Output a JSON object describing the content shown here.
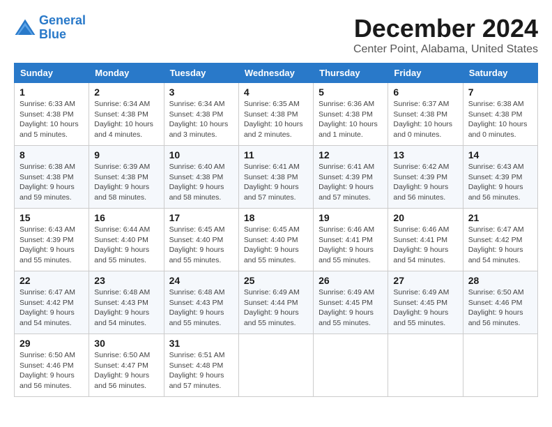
{
  "logo": {
    "line1": "General",
    "line2": "Blue"
  },
  "title": "December 2024",
  "subtitle": "Center Point, Alabama, United States",
  "weekdays": [
    "Sunday",
    "Monday",
    "Tuesday",
    "Wednesday",
    "Thursday",
    "Friday",
    "Saturday"
  ],
  "weeks": [
    [
      {
        "day": "1",
        "sunrise": "6:33 AM",
        "sunset": "4:38 PM",
        "daylight": "10 hours and 5 minutes."
      },
      {
        "day": "2",
        "sunrise": "6:34 AM",
        "sunset": "4:38 PM",
        "daylight": "10 hours and 4 minutes."
      },
      {
        "day": "3",
        "sunrise": "6:34 AM",
        "sunset": "4:38 PM",
        "daylight": "10 hours and 3 minutes."
      },
      {
        "day": "4",
        "sunrise": "6:35 AM",
        "sunset": "4:38 PM",
        "daylight": "10 hours and 2 minutes."
      },
      {
        "day": "5",
        "sunrise": "6:36 AM",
        "sunset": "4:38 PM",
        "daylight": "10 hours and 1 minute."
      },
      {
        "day": "6",
        "sunrise": "6:37 AM",
        "sunset": "4:38 PM",
        "daylight": "10 hours and 0 minutes."
      },
      {
        "day": "7",
        "sunrise": "6:38 AM",
        "sunset": "4:38 PM",
        "daylight": "10 hours and 0 minutes."
      }
    ],
    [
      {
        "day": "8",
        "sunrise": "6:38 AM",
        "sunset": "4:38 PM",
        "daylight": "9 hours and 59 minutes."
      },
      {
        "day": "9",
        "sunrise": "6:39 AM",
        "sunset": "4:38 PM",
        "daylight": "9 hours and 58 minutes."
      },
      {
        "day": "10",
        "sunrise": "6:40 AM",
        "sunset": "4:38 PM",
        "daylight": "9 hours and 58 minutes."
      },
      {
        "day": "11",
        "sunrise": "6:41 AM",
        "sunset": "4:38 PM",
        "daylight": "9 hours and 57 minutes."
      },
      {
        "day": "12",
        "sunrise": "6:41 AM",
        "sunset": "4:39 PM",
        "daylight": "9 hours and 57 minutes."
      },
      {
        "day": "13",
        "sunrise": "6:42 AM",
        "sunset": "4:39 PM",
        "daylight": "9 hours and 56 minutes."
      },
      {
        "day": "14",
        "sunrise": "6:43 AM",
        "sunset": "4:39 PM",
        "daylight": "9 hours and 56 minutes."
      }
    ],
    [
      {
        "day": "15",
        "sunrise": "6:43 AM",
        "sunset": "4:39 PM",
        "daylight": "9 hours and 55 minutes."
      },
      {
        "day": "16",
        "sunrise": "6:44 AM",
        "sunset": "4:40 PM",
        "daylight": "9 hours and 55 minutes."
      },
      {
        "day": "17",
        "sunrise": "6:45 AM",
        "sunset": "4:40 PM",
        "daylight": "9 hours and 55 minutes."
      },
      {
        "day": "18",
        "sunrise": "6:45 AM",
        "sunset": "4:40 PM",
        "daylight": "9 hours and 55 minutes."
      },
      {
        "day": "19",
        "sunrise": "6:46 AM",
        "sunset": "4:41 PM",
        "daylight": "9 hours and 55 minutes."
      },
      {
        "day": "20",
        "sunrise": "6:46 AM",
        "sunset": "4:41 PM",
        "daylight": "9 hours and 54 minutes."
      },
      {
        "day": "21",
        "sunrise": "6:47 AM",
        "sunset": "4:42 PM",
        "daylight": "9 hours and 54 minutes."
      }
    ],
    [
      {
        "day": "22",
        "sunrise": "6:47 AM",
        "sunset": "4:42 PM",
        "daylight": "9 hours and 54 minutes."
      },
      {
        "day": "23",
        "sunrise": "6:48 AM",
        "sunset": "4:43 PM",
        "daylight": "9 hours and 54 minutes."
      },
      {
        "day": "24",
        "sunrise": "6:48 AM",
        "sunset": "4:43 PM",
        "daylight": "9 hours and 55 minutes."
      },
      {
        "day": "25",
        "sunrise": "6:49 AM",
        "sunset": "4:44 PM",
        "daylight": "9 hours and 55 minutes."
      },
      {
        "day": "26",
        "sunrise": "6:49 AM",
        "sunset": "4:45 PM",
        "daylight": "9 hours and 55 minutes."
      },
      {
        "day": "27",
        "sunrise": "6:49 AM",
        "sunset": "4:45 PM",
        "daylight": "9 hours and 55 minutes."
      },
      {
        "day": "28",
        "sunrise": "6:50 AM",
        "sunset": "4:46 PM",
        "daylight": "9 hours and 56 minutes."
      }
    ],
    [
      {
        "day": "29",
        "sunrise": "6:50 AM",
        "sunset": "4:46 PM",
        "daylight": "9 hours and 56 minutes."
      },
      {
        "day": "30",
        "sunrise": "6:50 AM",
        "sunset": "4:47 PM",
        "daylight": "9 hours and 56 minutes."
      },
      {
        "day": "31",
        "sunrise": "6:51 AM",
        "sunset": "4:48 PM",
        "daylight": "9 hours and 57 minutes."
      },
      null,
      null,
      null,
      null
    ]
  ]
}
